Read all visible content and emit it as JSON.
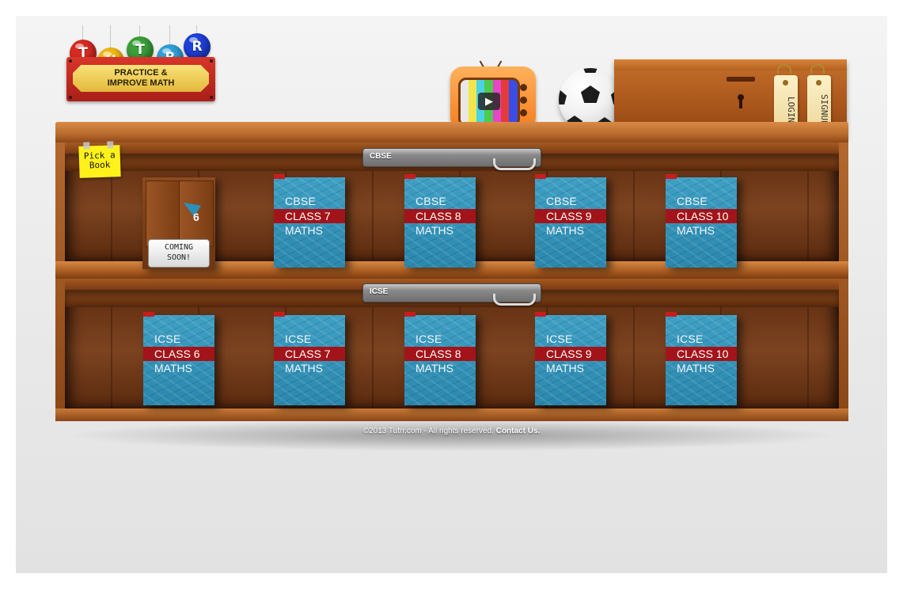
{
  "logo": {
    "letters": [
      {
        "char": "T",
        "color": "#d62b22"
      },
      {
        "char": "U",
        "color": "#f0b812"
      },
      {
        "char": "T",
        "color": "#3aa03a"
      },
      {
        "char": "R",
        "color": "#2f9fd8"
      },
      {
        "char": "R",
        "color": "#1f3fd8"
      }
    ],
    "tagline_line1": "PRACTICE &",
    "tagline_line2": "IMPROVE MATH"
  },
  "decor": {
    "tv_icon": "tv-play-icon",
    "ball_icon": "soccer-ball-icon",
    "box_icon": "locked-box-icon"
  },
  "tags": {
    "login": "LOGIN",
    "signup": "SIGNUP"
  },
  "sticky_note": {
    "line1": "Pick a",
    "line2": "Book"
  },
  "sections": [
    {
      "label": "CBSE",
      "placeholder": {
        "number": "6",
        "status_line1": "COMING",
        "status_line2": "SOON!"
      },
      "books": [
        {
          "board": "CBSE",
          "class": "CLASS 7",
          "subject": "MATHS"
        },
        {
          "board": "CBSE",
          "class": "CLASS 8",
          "subject": "MATHS"
        },
        {
          "board": "CBSE",
          "class": "CLASS 9",
          "subject": "MATHS"
        },
        {
          "board": "CBSE",
          "class": "CLASS 10",
          "subject": "MATHS"
        }
      ]
    },
    {
      "label": "ICSE",
      "books": [
        {
          "board": "ICSE",
          "class": "CLASS 6",
          "subject": "MATHS"
        },
        {
          "board": "ICSE",
          "class": "CLASS 7",
          "subject": "MATHS"
        },
        {
          "board": "ICSE",
          "class": "CLASS 8",
          "subject": "MATHS"
        },
        {
          "board": "ICSE",
          "class": "CLASS 9",
          "subject": "MATHS"
        },
        {
          "board": "ICSE",
          "class": "CLASS 10",
          "subject": "MATHS"
        }
      ]
    }
  ],
  "footer": {
    "copyright": "©2013 Tutrr.com - All rights reserved.",
    "contact": "Contact Us."
  },
  "colors": {
    "book_cover": "#3296bd",
    "book_band": "#a3141a",
    "shelf_wood": "#b86b2c",
    "sticky": "#fff21a"
  }
}
